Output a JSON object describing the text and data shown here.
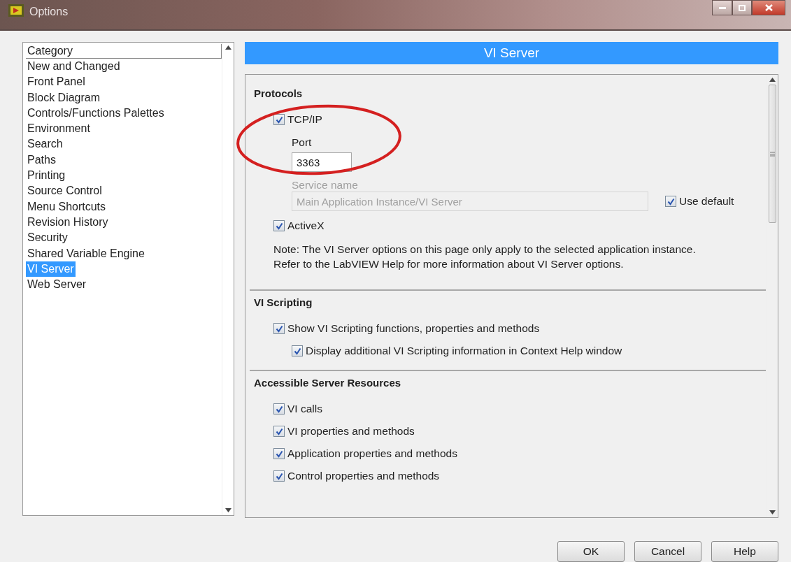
{
  "window": {
    "title": "Options"
  },
  "category_list": {
    "header": "Category",
    "items": [
      {
        "label": "New and Changed",
        "selected": false
      },
      {
        "label": "Front Panel",
        "selected": false
      },
      {
        "label": "Block Diagram",
        "selected": false
      },
      {
        "label": "Controls/Functions Palettes",
        "selected": false
      },
      {
        "label": "Environment",
        "selected": false
      },
      {
        "label": "Search",
        "selected": false
      },
      {
        "label": "Paths",
        "selected": false
      },
      {
        "label": "Printing",
        "selected": false
      },
      {
        "label": "Source Control",
        "selected": false
      },
      {
        "label": "Menu Shortcuts",
        "selected": false
      },
      {
        "label": "Revision History",
        "selected": false
      },
      {
        "label": "Security",
        "selected": false
      },
      {
        "label": "Shared Variable Engine",
        "selected": false
      },
      {
        "label": "VI Server",
        "selected": true
      },
      {
        "label": "Web Server",
        "selected": false
      }
    ]
  },
  "page_title": "VI Server",
  "protocols": {
    "heading": "Protocols",
    "tcp_ip": {
      "label": "TCP/IP",
      "checked": true
    },
    "port": {
      "label": "Port",
      "value": "3363"
    },
    "service_name": {
      "label": "Service name",
      "value": "Main Application Instance/VI Server",
      "disabled": true
    },
    "use_default": {
      "label": "Use default",
      "checked": true
    },
    "activex": {
      "label": "ActiveX",
      "checked": true
    },
    "note": [
      "Note: The VI Server options on this page only apply to the selected application instance.",
      "Refer to the LabVIEW Help for more information about VI Server options."
    ]
  },
  "vi_scripting": {
    "heading": "VI Scripting",
    "options": [
      {
        "label": "Show VI Scripting functions, properties and methods",
        "checked": true,
        "indent": false
      },
      {
        "label": "Display additional VI Scripting information in Context Help window",
        "checked": true,
        "indent": true
      }
    ]
  },
  "accessible_resources": {
    "heading": "Accessible Server Resources",
    "options": [
      {
        "label": "VI calls",
        "checked": true
      },
      {
        "label": "VI properties and methods",
        "checked": true
      },
      {
        "label": "Application properties and methods",
        "checked": true
      },
      {
        "label": "Control properties and methods",
        "checked": true
      }
    ]
  },
  "buttons": [
    "OK",
    "Cancel",
    "Help"
  ]
}
